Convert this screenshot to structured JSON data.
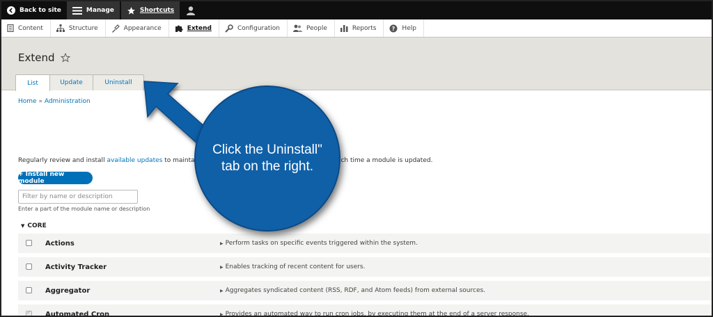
{
  "toolbar": {
    "back_label": "Back to site",
    "manage_label": "Manage",
    "shortcuts_label": "Shortcuts"
  },
  "tray": {
    "items": [
      {
        "label": "Content",
        "icon": "content-icon"
      },
      {
        "label": "Structure",
        "icon": "structure-icon"
      },
      {
        "label": "Appearance",
        "icon": "appearance-icon"
      },
      {
        "label": "Extend",
        "icon": "puzzle-icon",
        "active": true
      },
      {
        "label": "Configuration",
        "icon": "wrench-icon"
      },
      {
        "label": "People",
        "icon": "people-icon"
      },
      {
        "label": "Reports",
        "icon": "reports-icon"
      },
      {
        "label": "Help",
        "icon": "help-icon"
      }
    ]
  },
  "header": {
    "title": "Extend",
    "tabs": [
      {
        "label": "List",
        "active": true
      },
      {
        "label": "Update"
      },
      {
        "label": "Uninstall"
      }
    ]
  },
  "breadcrumb": {
    "home": "Home",
    "separator": "»",
    "admin": "Administration"
  },
  "intro": {
    "prefix": "Regularly review and install ",
    "link": "available updates",
    "middle": " to maintain a s",
    "tail": "t each time a module is updated."
  },
  "install_button": "+ Install new module",
  "filter": {
    "placeholder": "Filter by name or description",
    "help": "Enter a part of the module name or description"
  },
  "core_label": "CORE",
  "modules": [
    {
      "name": "Actions",
      "description": "Perform tasks on specific events triggered within the system.",
      "checked": false
    },
    {
      "name": "Activity Tracker",
      "description": "Enables tracking of recent content for users.",
      "checked": false
    },
    {
      "name": "Aggregator",
      "description": "Aggregates syndicated content (RSS, RDF, and Atom feeds) from external sources.",
      "checked": false
    },
    {
      "name": "Automated Cron",
      "description": "Provides an automated way to run cron jobs, by executing them at the end of a server response.",
      "checked": true
    }
  ],
  "callout": {
    "text": "Click the Uninstall\" tab on the right.",
    "color": "#1060a8"
  },
  "colors": {
    "link": "#0074bd",
    "toolbar": "#0f0f0f",
    "header_bg": "#e4e2dc",
    "button": "#0071b8"
  }
}
